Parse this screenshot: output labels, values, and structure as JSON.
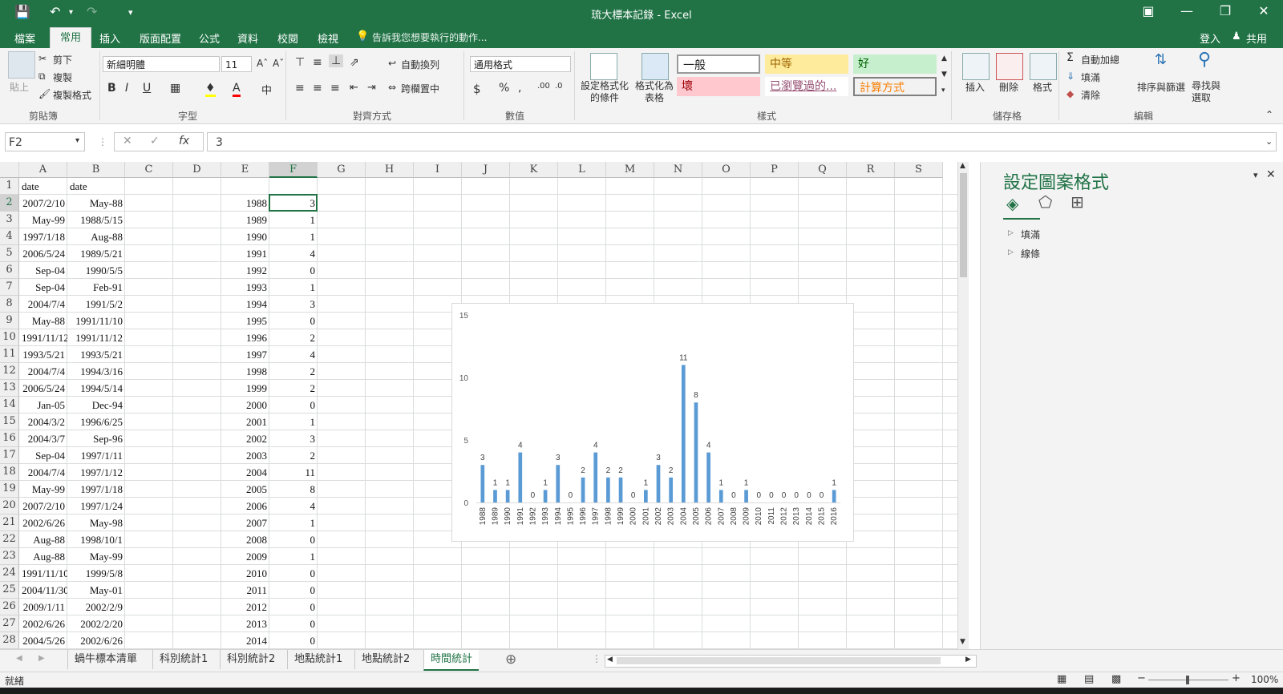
{
  "window": {
    "title": "琉大標本記錄 - Excel",
    "signin": "登入",
    "share": "共用"
  },
  "menu": {
    "tabs": [
      "檔案",
      "常用",
      "插入",
      "版面配置",
      "公式",
      "資料",
      "校閱",
      "檢視"
    ],
    "active_tab": "常用",
    "tell_me": "告訴我您想要執行的動作..."
  },
  "ribbon": {
    "clipboard": {
      "paste": "貼上",
      "cut": "剪下",
      "copy": "複製",
      "format_painter": "複製格式",
      "label": "剪貼簿"
    },
    "font": {
      "name": "新細明體",
      "size": "11",
      "label": "字型"
    },
    "alignment": {
      "wrap": "自動換列",
      "merge": "跨欄置中",
      "label": "對齊方式"
    },
    "number": {
      "format": "通用格式",
      "label": "數值"
    },
    "styles": {
      "conditional": "設定格式化的條件",
      "as_table": "格式化為表格",
      "normal": "一般",
      "neutral": "中等",
      "good": "好",
      "bad": "壞",
      "followed": "已瀏覽過的...",
      "calculation": "計算方式",
      "label": "樣式"
    },
    "cells": {
      "insert": "插入",
      "delete": "刪除",
      "format": "格式",
      "label": "儲存格"
    },
    "editing": {
      "autosum": "自動加總",
      "fill": "填滿",
      "clear": "清除",
      "sort": "排序與篩選",
      "find": "尋找與選取",
      "label": "編輯"
    }
  },
  "formula_bar": {
    "name_box": "F2",
    "fx": "fx",
    "value": "3"
  },
  "columns": [
    "A",
    "B",
    "C",
    "D",
    "E",
    "F",
    "G",
    "H",
    "I",
    "J",
    "K",
    "L",
    "M",
    "N",
    "O",
    "P",
    "Q",
    "R",
    "S"
  ],
  "selected_column": "F",
  "rows": [
    {
      "n": "1",
      "a": "date",
      "b": "date",
      "e": "",
      "f": ""
    },
    {
      "n": "2",
      "a": "2007/2/10",
      "b": "May-88",
      "e": "1988",
      "f": "3"
    },
    {
      "n": "3",
      "a": "May-99",
      "b": "1988/5/15",
      "e": "1989",
      "f": "1"
    },
    {
      "n": "4",
      "a": "1997/1/18",
      "b": "Aug-88",
      "e": "1990",
      "f": "1"
    },
    {
      "n": "5",
      "a": "2006/5/24",
      "b": "1989/5/21",
      "e": "1991",
      "f": "4"
    },
    {
      "n": "6",
      "a": "Sep-04",
      "b": "1990/5/5",
      "e": "1992",
      "f": "0"
    },
    {
      "n": "7",
      "a": "Sep-04",
      "b": "Feb-91",
      "e": "1993",
      "f": "1"
    },
    {
      "n": "8",
      "a": "2004/7/4",
      "b": "1991/5/2",
      "e": "1994",
      "f": "3"
    },
    {
      "n": "9",
      "a": "May-88",
      "b": "1991/11/10",
      "e": "1995",
      "f": "0"
    },
    {
      "n": "10",
      "a": "1991/11/12",
      "b": "1991/11/12",
      "e": "1996",
      "f": "2"
    },
    {
      "n": "11",
      "a": "1993/5/21",
      "b": "1993/5/21",
      "e": "1997",
      "f": "4"
    },
    {
      "n": "12",
      "a": "2004/7/4",
      "b": "1994/3/16",
      "e": "1998",
      "f": "2"
    },
    {
      "n": "13",
      "a": "2006/5/24",
      "b": "1994/5/14",
      "e": "1999",
      "f": "2"
    },
    {
      "n": "14",
      "a": "Jan-05",
      "b": "Dec-94",
      "e": "2000",
      "f": "0"
    },
    {
      "n": "15",
      "a": "2004/3/2",
      "b": "1996/6/25",
      "e": "2001",
      "f": "1"
    },
    {
      "n": "16",
      "a": "2004/3/7",
      "b": "Sep-96",
      "e": "2002",
      "f": "3"
    },
    {
      "n": "17",
      "a": "Sep-04",
      "b": "1997/1/11",
      "e": "2003",
      "f": "2"
    },
    {
      "n": "18",
      "a": "2004/7/4",
      "b": "1997/1/12",
      "e": "2004",
      "f": "11"
    },
    {
      "n": "19",
      "a": "May-99",
      "b": "1997/1/18",
      "e": "2005",
      "f": "8"
    },
    {
      "n": "20",
      "a": "2007/2/10",
      "b": "1997/1/24",
      "e": "2006",
      "f": "4"
    },
    {
      "n": "21",
      "a": "2002/6/26",
      "b": "May-98",
      "e": "2007",
      "f": "1"
    },
    {
      "n": "22",
      "a": "Aug-88",
      "b": "1998/10/1",
      "e": "2008",
      "f": "0"
    },
    {
      "n": "23",
      "a": "Aug-88",
      "b": "May-99",
      "e": "2009",
      "f": "1"
    },
    {
      "n": "24",
      "a": "1991/11/10",
      "b": "1999/5/8",
      "e": "2010",
      "f": "0"
    },
    {
      "n": "25",
      "a": "2004/11/30",
      "b": "May-01",
      "e": "2011",
      "f": "0"
    },
    {
      "n": "26",
      "a": "2009/1/11",
      "b": "2002/2/9",
      "e": "2012",
      "f": "0"
    },
    {
      "n": "27",
      "a": "2002/6/26",
      "b": "2002/2/20",
      "e": "2013",
      "f": "0"
    },
    {
      "n": "28",
      "a": "2004/5/26",
      "b": "2002/6/26",
      "e": "2014",
      "f": "0"
    }
  ],
  "chart_data": {
    "type": "bar",
    "categories": [
      "1988",
      "1989",
      "1990",
      "1991",
      "1992",
      "1993",
      "1994",
      "1995",
      "1996",
      "1997",
      "1998",
      "1999",
      "2000",
      "2001",
      "2002",
      "2003",
      "2004",
      "2005",
      "2006",
      "2007",
      "2008",
      "2009",
      "2010",
      "2011",
      "2012",
      "2013",
      "2014",
      "2015",
      "2016"
    ],
    "values": [
      3,
      1,
      1,
      4,
      0,
      1,
      3,
      0,
      2,
      4,
      2,
      2,
      0,
      1,
      3,
      2,
      11,
      8,
      4,
      1,
      0,
      1,
      0,
      0,
      0,
      0,
      0,
      0,
      1
    ],
    "title": "",
    "xlabel": "",
    "ylabel": "",
    "ylim": [
      0,
      15
    ],
    "yticks": [
      0,
      5,
      10,
      15
    ],
    "data_labels": true,
    "grid": false,
    "legend": "none",
    "bar_color": "#5b9bd5"
  },
  "format_pane": {
    "title": "設定圖案格式",
    "sections": [
      "填滿",
      "線條"
    ]
  },
  "sheet_tabs": [
    "蝸牛標本清單",
    "科別統計1",
    "科別統計2",
    "地點統計1",
    "地點統計2",
    "時間統計"
  ],
  "active_sheet": "時間統計",
  "status": {
    "text": "就緒",
    "zoom": "100%"
  },
  "colors": {
    "brand": "#217346",
    "bar": "#5b9bd5"
  }
}
